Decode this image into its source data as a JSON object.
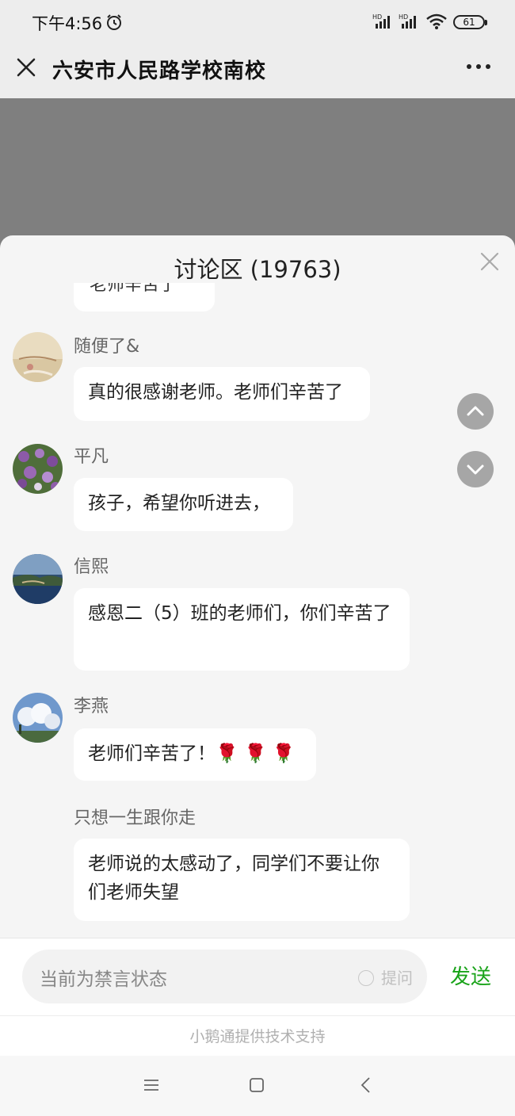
{
  "status": {
    "time": "下午4:56",
    "battery": "61",
    "icons": [
      "alarm-icon",
      "hd-signal-icon",
      "hd-signal-icon",
      "wifi-icon",
      "battery-icon"
    ]
  },
  "header": {
    "title": "六安市人民路学校南校",
    "close_icon": "close-icon",
    "more_icon": "more-icon"
  },
  "discussion": {
    "title": "讨论区 (19763)",
    "partial_message": "老师辛苦了",
    "messages": [
      {
        "user": "随便了&",
        "text": "真的很感谢老师。老师们辛苦了",
        "has_avatar": true
      },
      {
        "user": "平凡",
        "text": "孩子，希望你听进去，",
        "has_avatar": true
      },
      {
        "user": "信熙",
        "text": "感恩二（5）班的老师们，你们辛苦了",
        "has_avatar": true
      },
      {
        "user": "李燕",
        "text": "老师们辛苦了！🌹 🌹 🌹",
        "has_avatar": true
      },
      {
        "user": "只想一生跟你走",
        "text": "老师说的太感动了，同学们不要让你们老师失望",
        "has_avatar": false
      }
    ]
  },
  "input": {
    "placeholder": "当前为禁言状态",
    "ask_label": "提问",
    "send_label": "发送"
  },
  "footer": {
    "support_text": "小鹅通提供技术支持"
  },
  "colors": {
    "send_green": "#19a319",
    "video_grey": "#7f7f7f",
    "sheet_bg": "#f5f5f5"
  }
}
